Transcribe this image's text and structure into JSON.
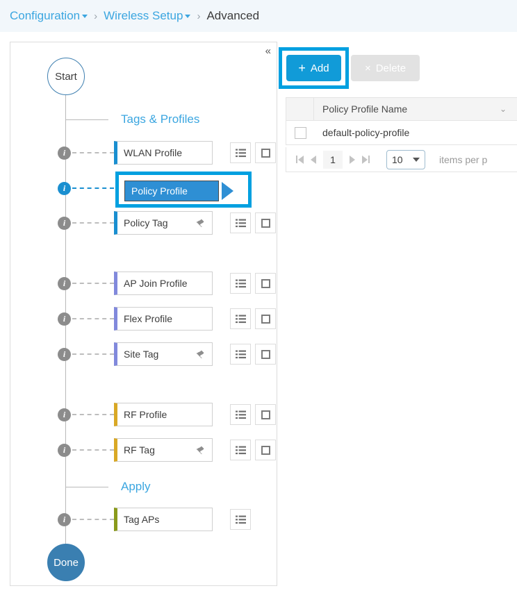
{
  "breadcrumb": {
    "items": [
      {
        "label": "Configuration",
        "has_caret": true,
        "current": false
      },
      {
        "label": "Wireless Setup",
        "has_caret": true,
        "current": false
      },
      {
        "label": "Advanced",
        "has_caret": false,
        "current": true
      }
    ],
    "separator": "›"
  },
  "workflow": {
    "collapse_icon": "«",
    "start_label": "Start",
    "done_label": "Done",
    "sections": [
      {
        "label": "Tags & Profiles"
      },
      {
        "label": "Apply"
      }
    ],
    "rows": [
      {
        "label": "WLAN Profile",
        "bar": "blue",
        "tag": false,
        "list": true,
        "check": true,
        "selected": false
      },
      {
        "label": "Policy Profile",
        "bar": "blue",
        "tag": false,
        "list": false,
        "check": false,
        "selected": true
      },
      {
        "label": "Policy Tag",
        "bar": "blue",
        "tag": true,
        "list": true,
        "check": true,
        "selected": false
      },
      {
        "label": "AP Join Profile",
        "bar": "purple",
        "tag": false,
        "list": true,
        "check": true,
        "selected": false
      },
      {
        "label": "Flex Profile",
        "bar": "purple",
        "tag": false,
        "list": true,
        "check": true,
        "selected": false
      },
      {
        "label": "Site Tag",
        "bar": "purple",
        "tag": true,
        "list": true,
        "check": true,
        "selected": false
      },
      {
        "label": "RF Profile",
        "bar": "gold",
        "tag": false,
        "list": true,
        "check": true,
        "selected": false
      },
      {
        "label": "RF Tag",
        "bar": "gold",
        "tag": true,
        "list": true,
        "check": true,
        "selected": false
      },
      {
        "label": "Tag APs",
        "bar": "olive",
        "tag": false,
        "list": true,
        "check": false,
        "selected": false
      }
    ],
    "tag_glyph": "⚑"
  },
  "toolbar": {
    "add_label": "Add",
    "add_icon": "+",
    "delete_label": "Delete",
    "delete_icon": "×"
  },
  "table": {
    "column_header": "Policy Profile Name",
    "sort_icon": "⌄",
    "rows": [
      {
        "name": "default-policy-profile",
        "checked": false
      }
    ]
  },
  "pagination": {
    "first_icon": "first-page",
    "prev_icon": "previous-page",
    "current_page": "1",
    "next_icon": "next-page",
    "last_icon": "last-page",
    "page_size": "10",
    "items_per_page_label": "items per p"
  },
  "colors": {
    "accent_blue": "#119bd8",
    "highlight_cyan": "#00a0e0",
    "link_blue": "#3ba6e0",
    "bar_blue": "#1a8fd0",
    "bar_purple": "#8189dc",
    "bar_gold": "#d9a825",
    "bar_olive": "#8a9a1b",
    "done_blue": "#3a7fb1"
  }
}
